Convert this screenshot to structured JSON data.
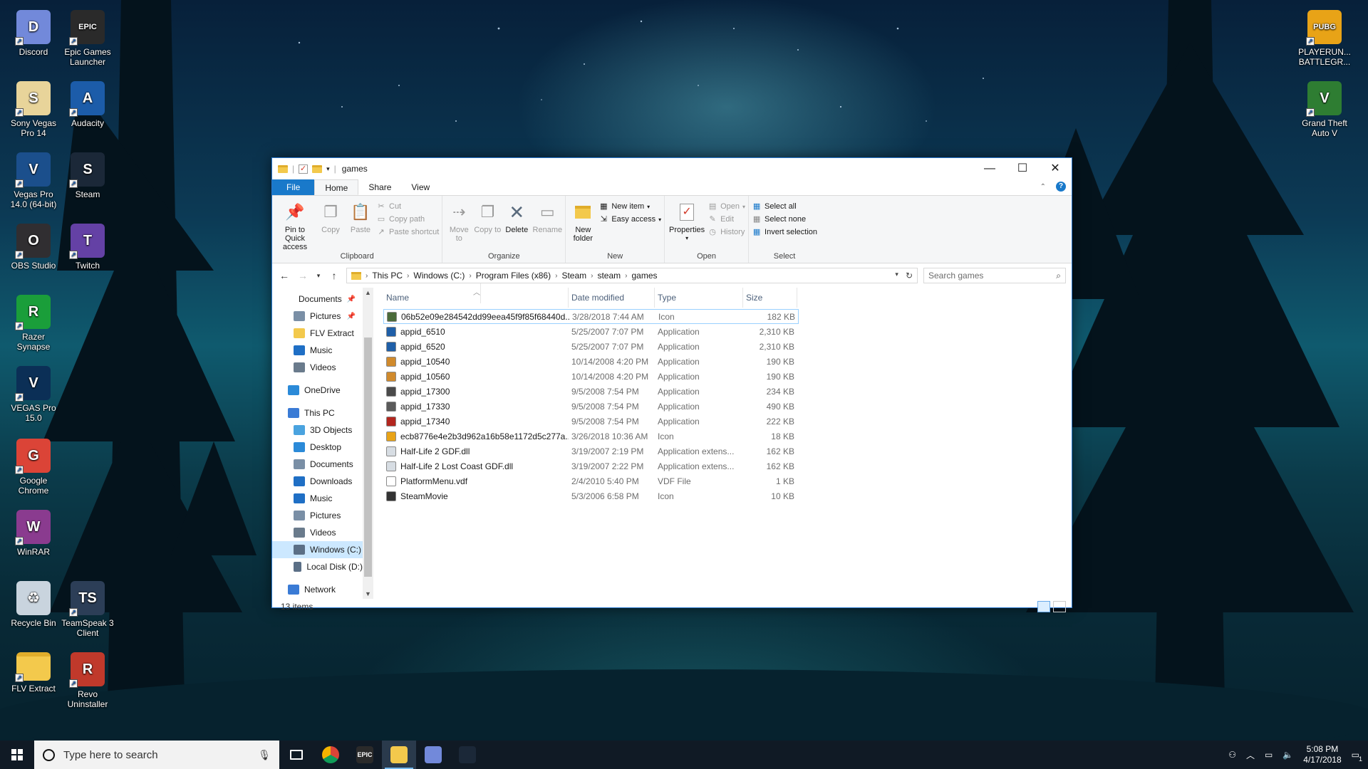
{
  "desktop": {
    "icons_left": [
      {
        "label": "Discord",
        "icon": "discord-icon",
        "color": "#7289da",
        "glyph": "D"
      },
      {
        "label": "Epic Games Launcher",
        "icon": "epic-games-icon",
        "color": "#2a2a2a",
        "glyph": "EPIC"
      },
      {
        "label": "Sony Vegas Pro 14",
        "icon": "sony-vegas-icon",
        "color": "#e8d49a",
        "glyph": "S"
      },
      {
        "label": "Audacity",
        "icon": "audacity-icon",
        "color": "#1c5ca9",
        "glyph": "A"
      },
      {
        "label": "Vegas Pro 14.0 (64-bit)",
        "icon": "vegas-pro-icon",
        "color": "#1b4f8c",
        "glyph": "V"
      },
      {
        "label": "Steam",
        "icon": "steam-icon",
        "color": "#1b2838",
        "glyph": "S"
      },
      {
        "label": "OBS Studio",
        "icon": "obs-icon",
        "color": "#302e31",
        "glyph": "O"
      },
      {
        "label": "Twitch",
        "icon": "twitch-icon",
        "color": "#6441a5",
        "glyph": "T"
      },
      {
        "label": "Razer Synapse",
        "icon": "razer-icon",
        "color": "#1a9e3a",
        "glyph": "R"
      },
      {
        "label": "VEGAS Pro 15.0",
        "icon": "vegas-15-icon",
        "color": "#0b2f56",
        "glyph": "V"
      },
      {
        "label": "Google Chrome",
        "icon": "chrome-icon",
        "color": "#db4437",
        "glyph": "G"
      },
      {
        "label": "WinRAR",
        "icon": "winrar-icon",
        "color": "#8a3b8f",
        "glyph": "W"
      },
      {
        "label": "Recycle Bin",
        "icon": "recycle-bin-icon",
        "color": "#c9d4de",
        "glyph": "♻"
      },
      {
        "label": "TeamSpeak 3 Client",
        "icon": "teamspeak-icon",
        "color": "#2c3e57",
        "glyph": "TS"
      },
      {
        "label": "FLV Extract",
        "icon": "folder-icon",
        "color": "#f3c94c",
        "glyph": ""
      },
      {
        "label": "Revo Uninstaller",
        "icon": "revo-icon",
        "color": "#c0392b",
        "glyph": "R"
      }
    ],
    "icons_right": [
      {
        "label": "PLAYERUN... BATTLEGR...",
        "icon": "pubg-icon",
        "color": "#e8a317",
        "glyph": "PUBG"
      },
      {
        "label": "Grand Theft Auto V",
        "icon": "gta-icon",
        "color": "#2e7d32",
        "glyph": "V"
      }
    ]
  },
  "window": {
    "title": "games",
    "tabs": {
      "file": "File",
      "home": "Home",
      "share": "Share",
      "view": "View"
    },
    "ribbon": {
      "clipboard": {
        "label": "Clipboard",
        "pin": "Pin to Quick access",
        "copy": "Copy",
        "paste": "Paste",
        "cut": "Cut",
        "copy_path": "Copy path",
        "paste_shortcut": "Paste shortcut"
      },
      "organize": {
        "label": "Organize",
        "move_to": "Move to",
        "copy_to": "Copy to",
        "delete": "Delete",
        "rename": "Rename"
      },
      "new": {
        "label": "New",
        "new_folder": "New folder",
        "new_item": "New item",
        "easy_access": "Easy access"
      },
      "open": {
        "label": "Open",
        "properties": "Properties",
        "open": "Open",
        "edit": "Edit",
        "history": "History"
      },
      "select": {
        "label": "Select",
        "select_all": "Select all",
        "select_none": "Select none",
        "invert": "Invert selection"
      }
    },
    "breadcrumb": [
      "This PC",
      "Windows (C:)",
      "Program Files (x86)",
      "Steam",
      "steam",
      "games"
    ],
    "search_placeholder": "Search games",
    "nav": {
      "quick": [
        {
          "label": "Documents",
          "pinned": true,
          "color": "#7a8fa6"
        },
        {
          "label": "Pictures",
          "pinned": true,
          "color": "#7a8fa6"
        },
        {
          "label": "FLV Extract",
          "pinned": false,
          "color": "#f3c94c"
        },
        {
          "label": "Music",
          "pinned": false,
          "color": "#1f6fc5"
        },
        {
          "label": "Videos",
          "pinned": false,
          "color": "#6a7b8c"
        }
      ],
      "onedrive": "OneDrive",
      "this_pc": "This PC",
      "pc_items": [
        {
          "label": "3D Objects",
          "color": "#4aa3df"
        },
        {
          "label": "Desktop",
          "color": "#2b8ad8"
        },
        {
          "label": "Documents",
          "color": "#7a8fa6"
        },
        {
          "label": "Downloads",
          "color": "#1f6fc5"
        },
        {
          "label": "Music",
          "color": "#1f6fc5"
        },
        {
          "label": "Pictures",
          "color": "#7a8fa6"
        },
        {
          "label": "Videos",
          "color": "#6a7b8c"
        },
        {
          "label": "Windows (C:)",
          "color": "#5b6f86",
          "selected": true
        },
        {
          "label": "Local Disk (D:)",
          "color": "#5b6f86"
        }
      ],
      "network": "Network"
    },
    "columns": {
      "name": "Name",
      "date": "Date modified",
      "type": "Type",
      "size": "Size"
    },
    "files": [
      {
        "name": "06b52e09e284542dd99eea45f9f85f68440d...",
        "date": "3/28/2018 7:44 AM",
        "type": "Icon",
        "size": "182 KB",
        "icon_color": "#4a6b3a"
      },
      {
        "name": "appid_6510",
        "date": "5/25/2007 7:07 PM",
        "type": "Application",
        "size": "2,310 KB",
        "icon_color": "#1f5fa8"
      },
      {
        "name": "appid_6520",
        "date": "5/25/2007 7:07 PM",
        "type": "Application",
        "size": "2,310 KB",
        "icon_color": "#1f5fa8"
      },
      {
        "name": "appid_10540",
        "date": "10/14/2008 4:20 PM",
        "type": "Application",
        "size": "190 KB",
        "icon_color": "#d08a2c"
      },
      {
        "name": "appid_10560",
        "date": "10/14/2008 4:20 PM",
        "type": "Application",
        "size": "190 KB",
        "icon_color": "#d08a2c"
      },
      {
        "name": "appid_17300",
        "date": "9/5/2008 7:54 PM",
        "type": "Application",
        "size": "234 KB",
        "icon_color": "#4a4a4a"
      },
      {
        "name": "appid_17330",
        "date": "9/5/2008 7:54 PM",
        "type": "Application",
        "size": "490 KB",
        "icon_color": "#5a5a5a"
      },
      {
        "name": "appid_17340",
        "date": "9/5/2008 7:54 PM",
        "type": "Application",
        "size": "222 KB",
        "icon_color": "#b3261e"
      },
      {
        "name": "ecb8776e4e2b3d962a16b58e1172d5c277a...",
        "date": "3/26/2018 10:36 AM",
        "type": "Icon",
        "size": "18 KB",
        "icon_color": "#e8a317"
      },
      {
        "name": "Half-Life 2 GDF.dll",
        "date": "3/19/2007 2:19 PM",
        "type": "Application extens...",
        "size": "162 KB",
        "icon_color": "#d7dde3"
      },
      {
        "name": "Half-Life 2 Lost Coast GDF.dll",
        "date": "3/19/2007 2:22 PM",
        "type": "Application extens...",
        "size": "162 KB",
        "icon_color": "#d7dde3"
      },
      {
        "name": "PlatformMenu.vdf",
        "date": "2/4/2010 5:40 PM",
        "type": "VDF File",
        "size": "1 KB",
        "icon_color": "#ffffff"
      },
      {
        "name": "SteamMovie",
        "date": "5/3/2006 6:58 PM",
        "type": "Icon",
        "size": "10 KB",
        "icon_color": "#333333"
      }
    ],
    "status": "13 items"
  },
  "taskbar": {
    "search_placeholder": "Type here to search",
    "apps": [
      {
        "name": "task-view",
        "color": "#101a25",
        "glyph": "",
        "active": false
      },
      {
        "name": "chrome",
        "color": "#db4437",
        "glyph": "",
        "active": false
      },
      {
        "name": "epic-games",
        "color": "#2a2a2a",
        "glyph": "EPIC",
        "active": false
      },
      {
        "name": "file-explorer",
        "color": "#f3c94c",
        "glyph": "",
        "active": true
      },
      {
        "name": "discord",
        "color": "#7289da",
        "glyph": "",
        "active": false
      },
      {
        "name": "steam",
        "color": "#1b2838",
        "glyph": "",
        "active": false
      }
    ],
    "time": "5:08 PM",
    "date": "4/17/2018",
    "notification_count": "1"
  },
  "colors": {
    "accent": "#1979ca",
    "selection": "#cce8ff"
  }
}
